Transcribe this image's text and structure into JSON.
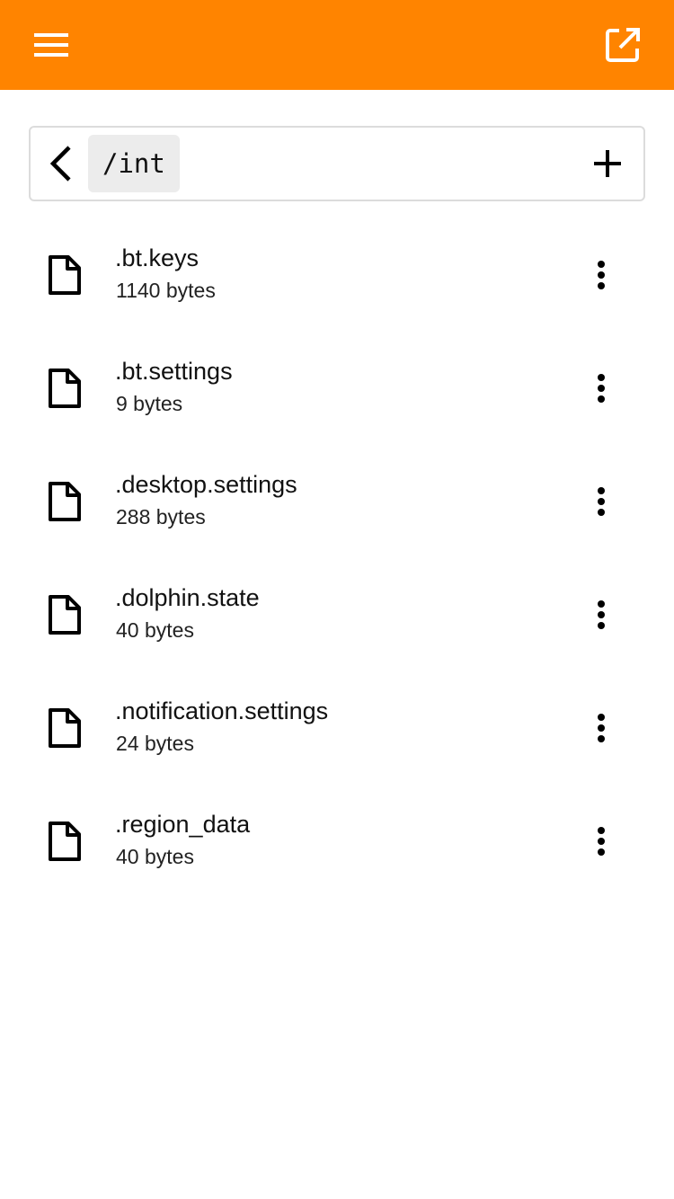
{
  "app_bar": {
    "color": "#ff8400",
    "menu_icon": "menu-icon",
    "open_icon": "open-in-new-icon"
  },
  "path_bar": {
    "back_icon": "chevron-left-icon",
    "path": "/int",
    "add_icon": "plus-icon"
  },
  "files": [
    {
      "name": ".bt.keys",
      "size": "1140 bytes"
    },
    {
      "name": ".bt.settings",
      "size": "9 bytes"
    },
    {
      "name": ".desktop.settings",
      "size": "288 bytes"
    },
    {
      "name": ".dolphin.state",
      "size": "40 bytes"
    },
    {
      "name": ".notification.settings",
      "size": "24 bytes"
    },
    {
      "name": ".region_data",
      "size": "40 bytes"
    }
  ],
  "file_row_icons": {
    "file_icon": "file-icon",
    "more_icon": "more-vertical-icon"
  }
}
